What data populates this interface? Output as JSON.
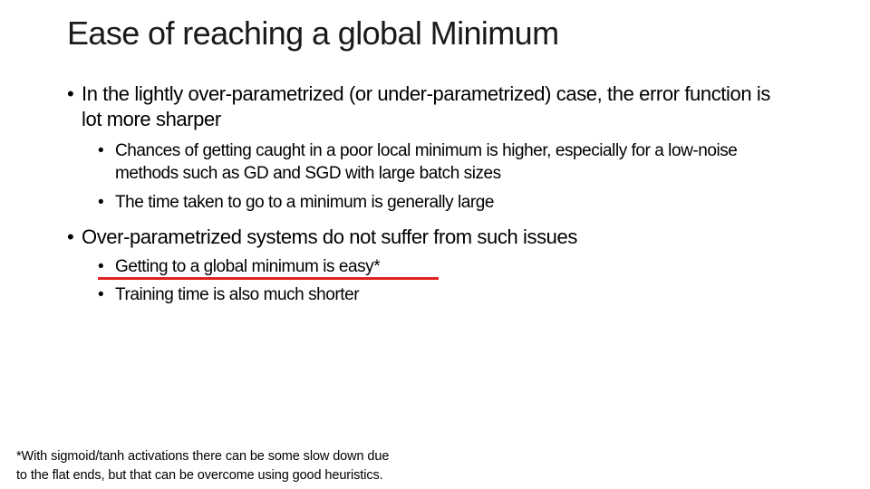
{
  "slide": {
    "title": "Ease of reaching a global Minimum",
    "bullet_glyph": "•",
    "sections": [
      {
        "text": "In the lightly over-parametrized (or under-parametrized) case, the error function is lot more sharper",
        "sub_items": [
          "Chances of getting caught in a poor local minimum is higher, especially for a low-noise methods such as GD and SGD with large batch sizes",
          "The time taken to go to a minimum is generally large"
        ]
      },
      {
        "text": "Over-parametrized systems do not suffer from such issues",
        "sub_items": [
          "Getting to a global minimum is easy*",
          "Training time is also much shorter"
        ]
      }
    ],
    "highlight": {
      "target": "Getting to a global minimum is easy*",
      "color": "#e02020"
    },
    "footnote": {
      "line1": "*With sigmoid/tanh activations there can be some slow down due",
      "line2": "to the flat ends, but that can be overcome using good heuristics."
    }
  }
}
